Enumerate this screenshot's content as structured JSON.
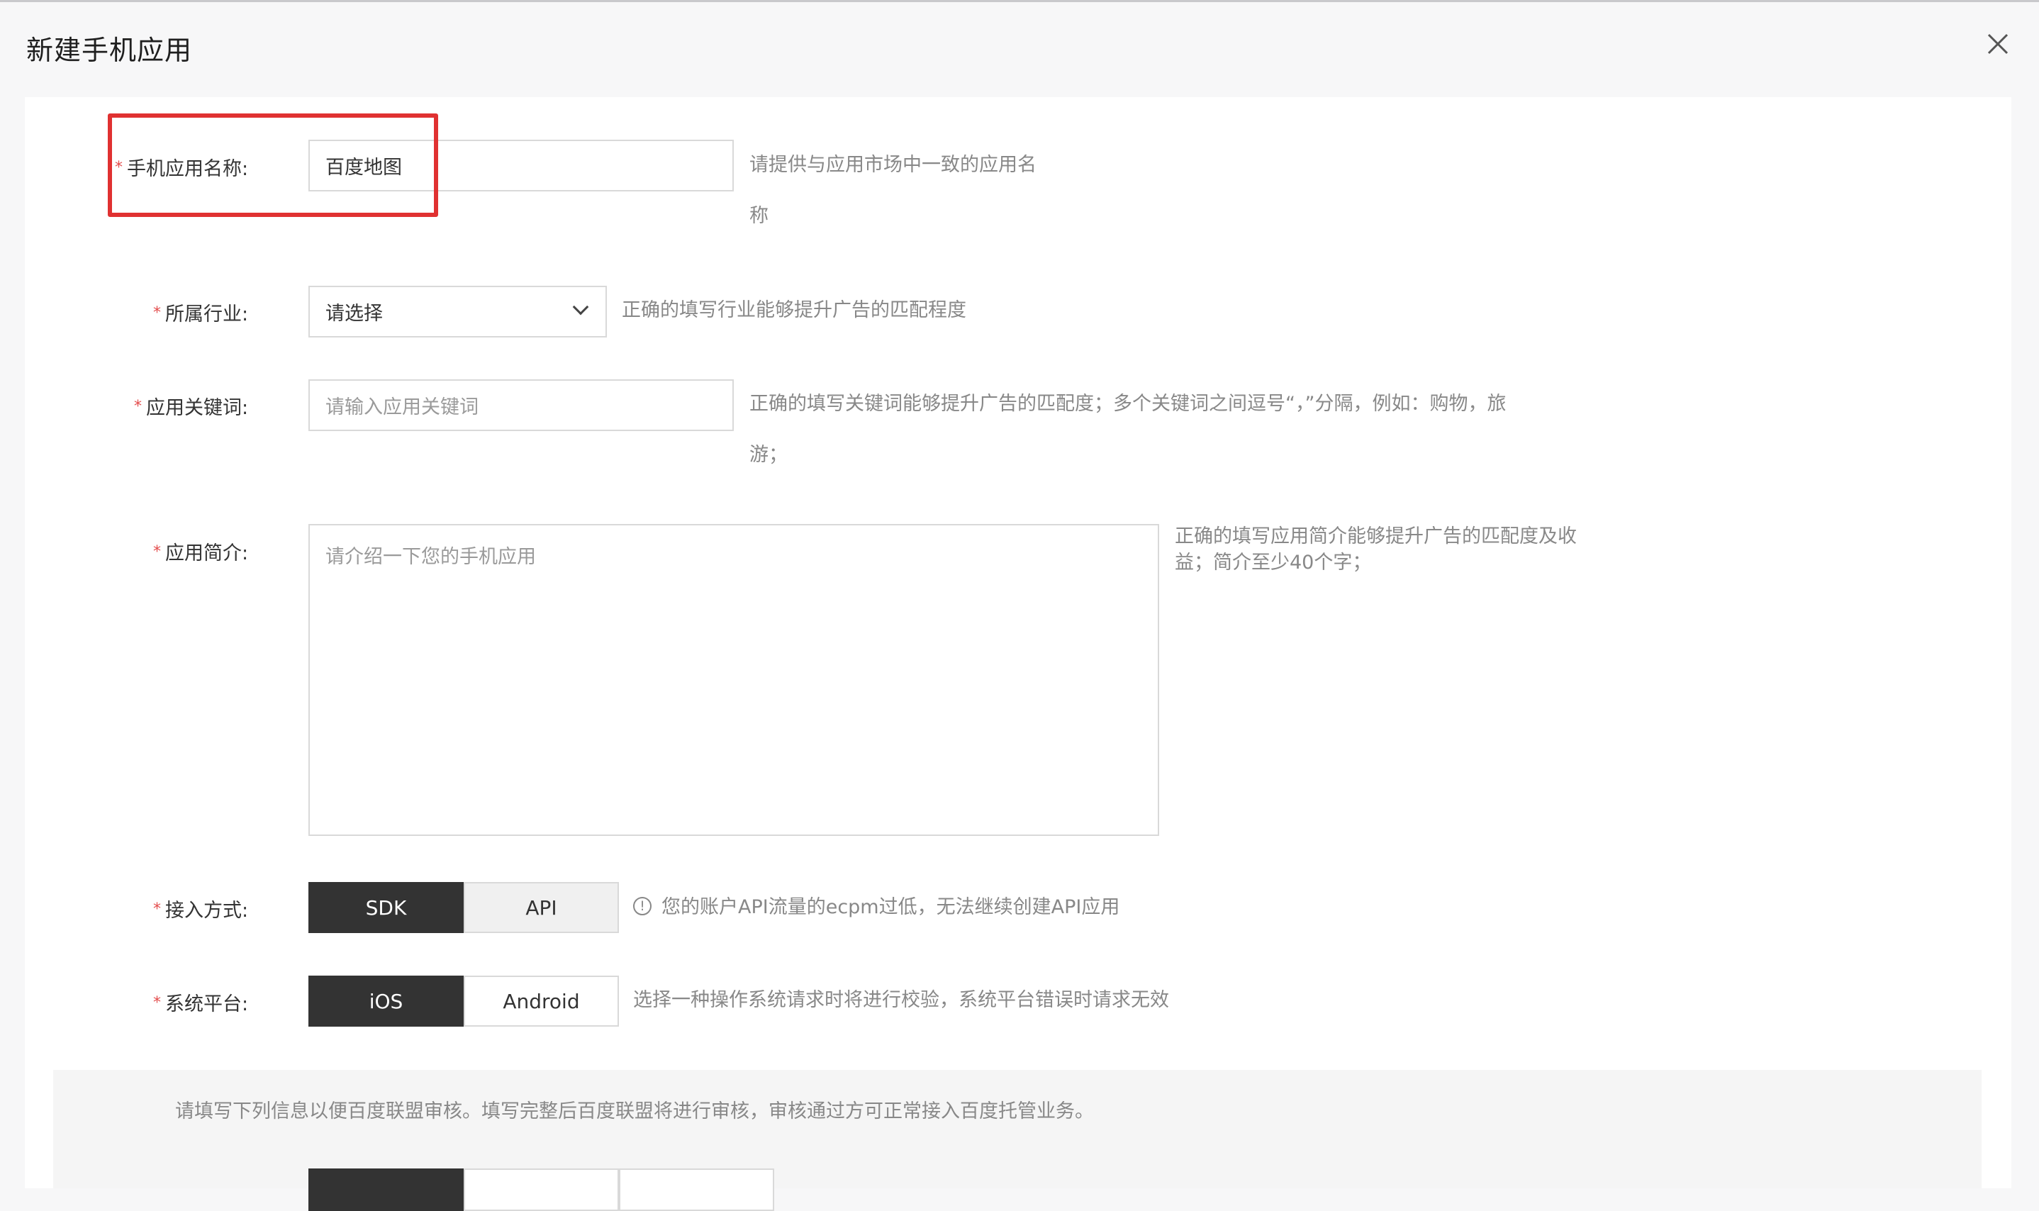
{
  "dialog": {
    "title": "新建手机应用"
  },
  "form": {
    "app_name": {
      "label": "手机应用名称:",
      "value": "百度地图",
      "hint_line1": "请提供与应用市场中一致的应用名",
      "hint_line2": "称"
    },
    "industry": {
      "label": "所属行业:",
      "value": "请选择",
      "hint": "正确的填写行业能够提升广告的匹配程度"
    },
    "keywords": {
      "label": "应用关键词:",
      "placeholder": "请输入应用关键词",
      "hint_line1": "正确的填写关键词能够提升广告的匹配度；多个关键词之间逗号“，”分隔，例如：购物，旅",
      "hint_line2": "游；"
    },
    "description": {
      "label": "应用简介:",
      "placeholder": "请介绍一下您的手机应用",
      "hint_line1": "正确的填写应用简介能够提升广告的匹配度及收",
      "hint_line2": "益；简介至少40个字；"
    },
    "access": {
      "label": "接入方式:",
      "options": [
        "SDK",
        "API"
      ],
      "selected": "SDK",
      "hint": "您的账户API流量的ecpm过低，无法继续创建API应用"
    },
    "platform": {
      "label": "系统平台:",
      "options": [
        "iOS",
        "Android"
      ],
      "selected": "iOS",
      "hint": "选择一种操作系统请求时将进行校验，系统平台错误时请求无效"
    },
    "notice": "请填写下列信息以便百度联盟审核。填写完整后百度联盟将进行审核，审核通过方可正常接入百度托管业务。"
  },
  "colors": {
    "accent_dark": "#333333",
    "required_star": "#e34d4d",
    "highlight_box": "#e03131"
  },
  "icons": {
    "close": "close-icon",
    "dropdown": "chevron-down-icon",
    "warning": "exclamation-circle-icon"
  }
}
